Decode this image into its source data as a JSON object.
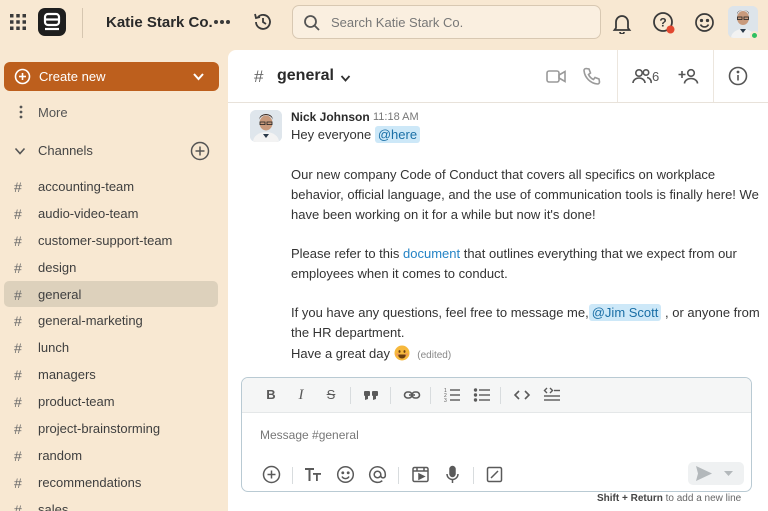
{
  "topbar": {
    "workspace_name": "Katie Stark Co.",
    "search_placeholder": "Search Katie Stark Co.",
    "icons": [
      "apps-grid-icon",
      "logo",
      "more-icon",
      "history-icon",
      "search-icon",
      "bell-icon",
      "help-icon",
      "emoji-icon",
      "avatar"
    ]
  },
  "sidebar": {
    "create_label": "Create new",
    "more_label": "More",
    "channels_header": "Channels",
    "channels": [
      {
        "name": "accounting-team",
        "active": false
      },
      {
        "name": "audio-video-team",
        "active": false
      },
      {
        "name": "customer-support-team",
        "active": false
      },
      {
        "name": "design",
        "active": false
      },
      {
        "name": "general",
        "active": true
      },
      {
        "name": "general-marketing",
        "active": false
      },
      {
        "name": "lunch",
        "active": false
      },
      {
        "name": "managers",
        "active": false
      },
      {
        "name": "product-team",
        "active": false
      },
      {
        "name": "project-brainstorming",
        "active": false
      },
      {
        "name": "random",
        "active": false
      },
      {
        "name": "recommendations",
        "active": false
      },
      {
        "name": "sales",
        "active": false
      }
    ]
  },
  "channel": {
    "hash": "#",
    "title": "general",
    "member_count": "6"
  },
  "message": {
    "author": "Nick Johnson",
    "time": "11:18 AM",
    "greeting": "Hey everyone",
    "mention_here": "@here",
    "p1_l1": "Our new company Code of Conduct that covers all specifics on workplace",
    "p1_l2": "behavior, official language, and the use of communication tools is finally here! We",
    "p1_l3": "have been working on it for a while but now it's done!",
    "p2_pre": "Please refer to this ",
    "p2_link": "document",
    "p2_post": " that outlines everything that we expect from our",
    "p2_l2": "employees when it comes to conduct.",
    "p3_pre": "If you have any questions, feel free to message me,",
    "p3_mention": "@Jim Scott",
    "p3_post": ", or anyone from",
    "p3_l2": "the HR department.",
    "closing": "Have a great day",
    "edited": "(edited)"
  },
  "composer": {
    "placeholder": "Message #general",
    "format_tools": [
      "bold-icon",
      "italic-icon",
      "strikethrough-icon",
      "quote-icon",
      "link-icon",
      "numbered-list-icon",
      "bullet-list-icon",
      "code-icon",
      "code-block-icon"
    ],
    "action_tools": [
      "add-icon",
      "text-format-icon",
      "emoji-icon",
      "mention-icon",
      "video-clip-icon",
      "microphone-icon",
      "slash-command-icon"
    ],
    "hint_keys": "Shift + Return",
    "hint_text": " to add a new line"
  },
  "colors": {
    "sidebar_bg": "#f8e8d2",
    "accent": "#bd5f1d",
    "active_channel": "#ddd1bc",
    "mention_bg": "#cde8f8",
    "link": "#2483c5",
    "online": "#2ebf60"
  }
}
